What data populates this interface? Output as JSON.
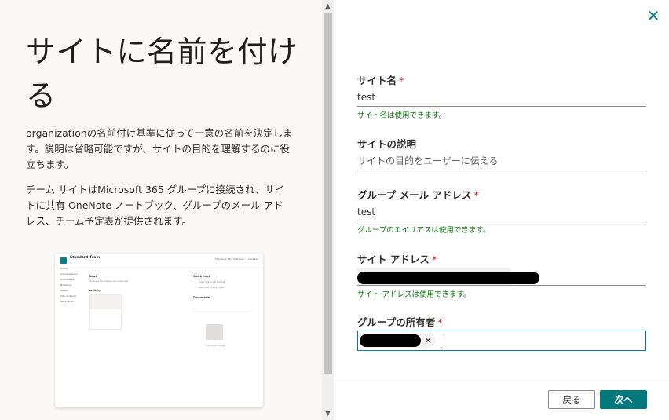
{
  "left": {
    "title": "サイトに名前を付ける",
    "description_1": "organizationの名前付け基準に従って一意の名前を決定します。説明は省略可能ですが、サイトの目的を理解するのに役立ちます。",
    "description_2": "チーム サイトはMicrosoft 365 グループに接続され、サイトに共有 OneNote ノートブック、グループのメール アドレス、チーム予定表が提供されます。",
    "preview": {
      "site_title": "Standard Team",
      "top_right": "Following · Not following · 1 member",
      "nav_items": [
        "Home",
        "Conversations",
        "Documents",
        "Notebook",
        "Pages",
        "Site contents",
        "Recycle bin"
      ],
      "news_heading": "News",
      "news_text": "Showcase this heading and notes here",
      "activity_heading": "Activity",
      "quicklinks_heading": "Quick links",
      "quicklinks": [
        "Learn how to use this site",
        "Learn how to add a page"
      ],
      "documents_heading": "Documents",
      "docs_empty": "This folder is empty"
    }
  },
  "form": {
    "site_name_label": "サイト名",
    "site_name_value": "test",
    "site_name_msg": "サイト名は使用できます。",
    "desc_label": "サイトの説明",
    "desc_placeholder": "サイトの目的をユーザーに伝える",
    "email_label": "グループ メール アドレス",
    "email_value": "test",
    "email_msg": "グループのエイリアスは使用できます。",
    "address_label": "サイト アドレス",
    "address_msg": "サイト アドレスは使用できます。",
    "owner_label": "グループの所有者",
    "required_mark": "*"
  },
  "buttons": {
    "back": "戻る",
    "next": "次へ"
  },
  "icons": {
    "close": "close-icon",
    "scroll_up": "scroll-up-icon",
    "scroll_down": "scroll-down-icon"
  },
  "colors": {
    "accent": "#03787c",
    "success": "#107c10",
    "required": "#a4262c"
  }
}
